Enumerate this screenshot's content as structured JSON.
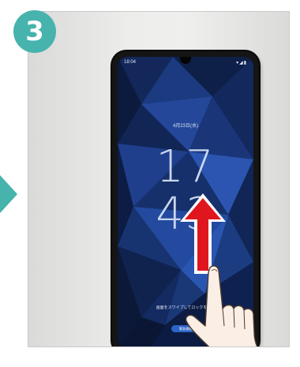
{
  "step": {
    "number": "3",
    "badge_color": "#46b3ad"
  },
  "phone": {
    "status_time": "18:04",
    "status_icons": "▾◢▮",
    "lock_date": "4月23日(水)",
    "clock_hour": "17",
    "clock_minute": "43",
    "unlock_hint": "画面をスワイプしてロックを解除",
    "emergency_label": "緊急通報"
  },
  "arrow": {
    "direction": "up",
    "color": "#e0161f",
    "outline": "#ffffff"
  },
  "icons": {
    "side_arrow": "triangle-right-icon",
    "swipe": "swipe-up-arrow-icon",
    "hand": "pointing-hand-icon"
  }
}
